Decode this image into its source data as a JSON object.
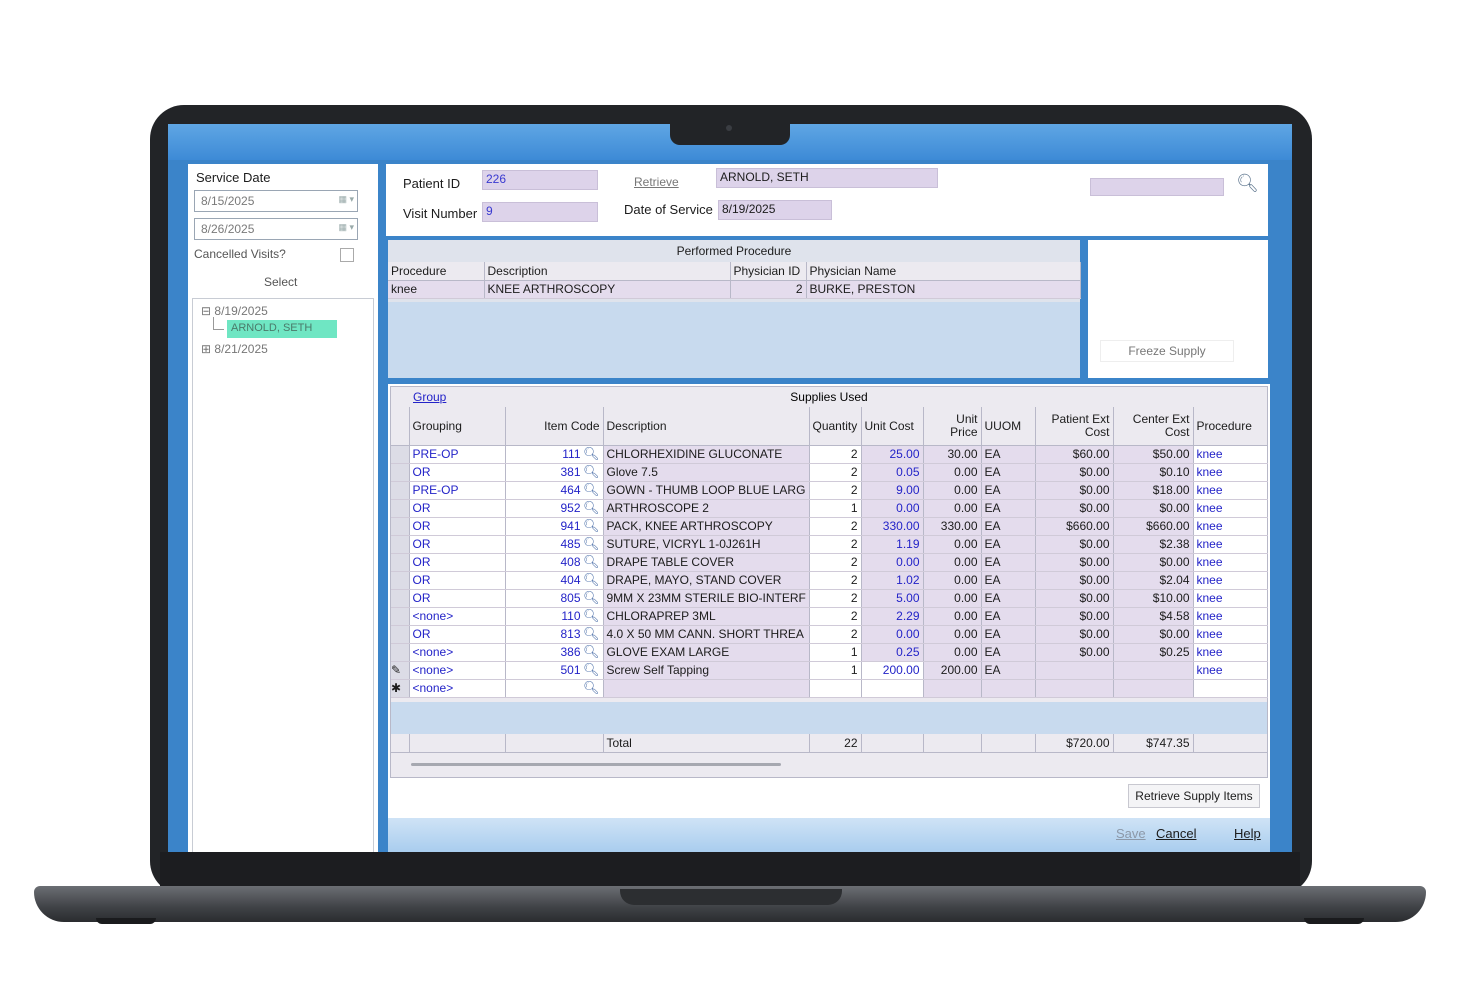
{
  "left_panel": {
    "service_date_label": "Service Date",
    "date_from": "8/15/2025",
    "date_to": "8/26/2025",
    "cancelled_label": "Cancelled Visits?",
    "select_label": "Select",
    "tree": [
      {
        "date": "8/19/2025",
        "expanded": true,
        "children": [
          "ARNOLD, SETH"
        ]
      },
      {
        "date": "8/21/2025",
        "expanded": false,
        "children": []
      }
    ]
  },
  "header": {
    "patient_id_label": "Patient ID",
    "patient_id": "226",
    "retrieve_label": "Retrieve",
    "patient_name": "ARNOLD, SETH",
    "visit_number_label": "Visit Number",
    "visit_number": "9",
    "date_of_service_label": "Date of Service",
    "date_of_service": "8/19/2025"
  },
  "performed": {
    "title": "Performed Procedure",
    "columns": [
      "Procedure",
      "Description",
      "Physician ID",
      "Physician Name"
    ],
    "rows": [
      {
        "procedure": "knee",
        "description": "KNEE ARTHROSCOPY",
        "physician_id": "2",
        "physician_name": "BURKE, PRESTON"
      }
    ]
  },
  "freeze_label": "Freeze Supply",
  "supplies": {
    "group_link": "Group",
    "title": "Supplies Used",
    "columns": [
      "Grouping",
      "Item Code",
      "Description",
      "Quantity",
      "Unit Cost",
      "Unit Price",
      "UUOM",
      "Patient Ext Cost",
      "Center Ext Cost",
      "Procedure"
    ],
    "rows": [
      {
        "grouping": "PRE-OP",
        "code": "111",
        "desc": "CHLORHEXIDINE GLUCONATE",
        "qty": "2",
        "ucost": "25.00",
        "uprice": "30.00",
        "uuom": "EA",
        "pext": "$60.00",
        "cext": "$50.00",
        "proc": "knee"
      },
      {
        "grouping": "OR",
        "code": "381",
        "desc": "Glove 7.5",
        "qty": "2",
        "ucost": "0.05",
        "uprice": "0.00",
        "uuom": "EA",
        "pext": "$0.00",
        "cext": "$0.10",
        "proc": "knee"
      },
      {
        "grouping": "PRE-OP",
        "code": "464",
        "desc": "GOWN - THUMB LOOP BLUE LARG",
        "qty": "2",
        "ucost": "9.00",
        "uprice": "0.00",
        "uuom": "EA",
        "pext": "$0.00",
        "cext": "$18.00",
        "proc": "knee"
      },
      {
        "grouping": "OR",
        "code": "952",
        "desc": "ARTHROSCOPE 2",
        "qty": "1",
        "ucost": "0.00",
        "uprice": "0.00",
        "uuom": "EA",
        "pext": "$0.00",
        "cext": "$0.00",
        "proc": "knee"
      },
      {
        "grouping": "OR",
        "code": "941",
        "desc": "PACK, KNEE ARTHROSCOPY",
        "qty": "2",
        "ucost": "330.00",
        "uprice": "330.00",
        "uuom": "EA",
        "pext": "$660.00",
        "cext": "$660.00",
        "proc": "knee"
      },
      {
        "grouping": "OR",
        "code": "485",
        "desc": "SUTURE, VICRYL 1-0J261H",
        "qty": "2",
        "ucost": "1.19",
        "uprice": "0.00",
        "uuom": "EA",
        "pext": "$0.00",
        "cext": "$2.38",
        "proc": "knee"
      },
      {
        "grouping": "OR",
        "code": "408",
        "desc": "DRAPE TABLE COVER",
        "qty": "2",
        "ucost": "0.00",
        "uprice": "0.00",
        "uuom": "EA",
        "pext": "$0.00",
        "cext": "$0.00",
        "proc": "knee"
      },
      {
        "grouping": "OR",
        "code": "404",
        "desc": "DRAPE, MAYO, STAND COVER",
        "qty": "2",
        "ucost": "1.02",
        "uprice": "0.00",
        "uuom": "EA",
        "pext": "$0.00",
        "cext": "$2.04",
        "proc": "knee"
      },
      {
        "grouping": "OR",
        "code": "805",
        "desc": "9MM X 23MM STERILE BIO-INTERF",
        "qty": "2",
        "ucost": "5.00",
        "uprice": "0.00",
        "uuom": "EA",
        "pext": "$0.00",
        "cext": "$10.00",
        "proc": "knee"
      },
      {
        "grouping": "<none>",
        "code": "110",
        "desc": "CHLORAPREP 3ML",
        "qty": "2",
        "ucost": "2.29",
        "uprice": "0.00",
        "uuom": "EA",
        "pext": "$0.00",
        "cext": "$4.58",
        "proc": "knee"
      },
      {
        "grouping": "OR",
        "code": "813",
        "desc": "4.0 X 50 MM CANN. SHORT THREA",
        "qty": "2",
        "ucost": "0.00",
        "uprice": "0.00",
        "uuom": "EA",
        "pext": "$0.00",
        "cext": "$0.00",
        "proc": "knee"
      },
      {
        "grouping": "<none>",
        "code": "386",
        "desc": "GLOVE EXAM LARGE",
        "qty": "1",
        "ucost": "0.25",
        "uprice": "0.00",
        "uuom": "EA",
        "pext": "$0.00",
        "cext": "$0.25",
        "proc": "knee"
      },
      {
        "grouping": "<none>",
        "code": "501",
        "desc": "Screw Self Tapping",
        "qty": "1",
        "ucost": "200.00",
        "uprice": "200.00",
        "uuom": "EA",
        "pext": "",
        "cext": "",
        "proc": "knee",
        "editing": true
      },
      {
        "grouping": "<none>",
        "code": "",
        "desc": "",
        "qty": "",
        "ucost": "",
        "uprice": "",
        "uuom": "",
        "pext": "",
        "cext": "",
        "proc": "",
        "new_row": true
      }
    ],
    "total_label": "Total",
    "total_qty": "22",
    "total_pext": "$720.00",
    "total_cext": "$747.35"
  },
  "buttons": {
    "retrieve_supply": "Retrieve Supply Items",
    "save": "Save",
    "cancel": "Cancel",
    "help": "Help"
  },
  "colors": {
    "window_blue": "#3b84c9",
    "field_purple": "#ddd3ea",
    "tree_highlight": "#6fe6c3",
    "link_blue": "#2323c8"
  },
  "icons": [
    "magnifier-icon",
    "calendar-icon",
    "pencil-icon",
    "asterisk-icon",
    "tree-expand-icon"
  ]
}
